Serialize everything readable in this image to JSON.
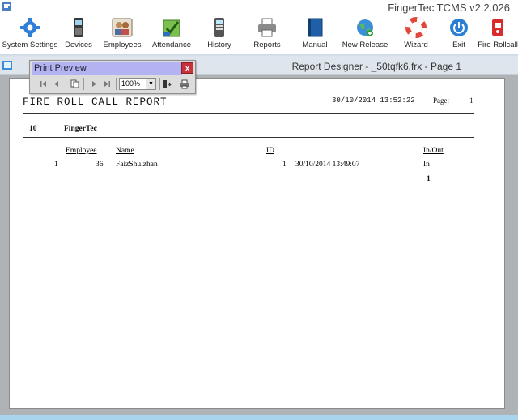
{
  "window": {
    "title": "FingerTec TCMS v2.2.026"
  },
  "toolbar": {
    "items": [
      {
        "label": "System Settings",
        "icon": "gear-icon"
      },
      {
        "label": "Devices",
        "icon": "fingerprint-device-icon"
      },
      {
        "label": "Employees",
        "icon": "employees-icon"
      },
      {
        "label": "Attendance",
        "icon": "attendance-icon"
      },
      {
        "label": "History",
        "icon": "history-icon"
      },
      {
        "label": "Reports",
        "icon": "printer-icon"
      },
      {
        "label": "Manual",
        "icon": "book-icon"
      },
      {
        "label": "New Release",
        "icon": "globe-icon"
      },
      {
        "label": "Wizard",
        "icon": "lifebuoy-icon"
      },
      {
        "label": "Exit",
        "icon": "power-icon"
      },
      {
        "label": "Fire Rollcall",
        "icon": "fire-alarm-icon"
      }
    ]
  },
  "designer": {
    "title": "Report Designer - _50tqfk6.frx - Page 1"
  },
  "print_preview": {
    "title": "Print Preview",
    "close_label": "x",
    "zoom_value": "100%"
  },
  "report": {
    "title": "FIRE ROLL CALL REPORT",
    "datetime": "30/10/2014 13:52:22",
    "page_label": "Page:",
    "page_number": "1",
    "group_id": "10",
    "group_name": "FingerTec",
    "columns": {
      "employee": "Employee",
      "name": "Name",
      "id": "ID",
      "in_out": "In/Out"
    },
    "rows": [
      {
        "seq": "1",
        "employee": "36",
        "name": "FaizShulzhan",
        "id": "1",
        "time": "30/10/2014 13:49:07",
        "in_out": "In"
      }
    ],
    "total": "1"
  }
}
